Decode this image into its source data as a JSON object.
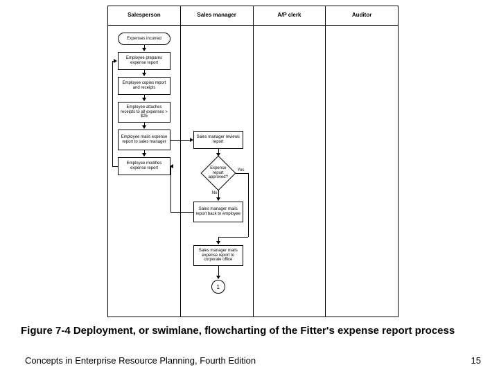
{
  "lanes": [
    "Salesperson",
    "Sales manager",
    "A/P clerk",
    "Auditor"
  ],
  "nodes": {
    "start": "Expenses incurred",
    "n1": "Employee prepares expense report",
    "n2": "Employee copies report and receipts",
    "n3": "Employee attaches receipts to all expenses > $25",
    "n4": "Employee mails expense report to sales manager",
    "n5": "Employee modifies expense report",
    "m1": "Sales manager reviews report",
    "d1": "Expense report approved?",
    "d1_no": "No",
    "d1_yes": "Yes",
    "m2": "Sales manager mails report back to employee",
    "m3": "Sales manager mails expense report to corporate office",
    "conn": "1"
  },
  "caption": "Figure 7-4  Deployment, or swimlane, flowcharting of the Fitter's expense report process",
  "footer": "Concepts in Enterprise Resource Planning, Fourth Edition",
  "page": "15"
}
